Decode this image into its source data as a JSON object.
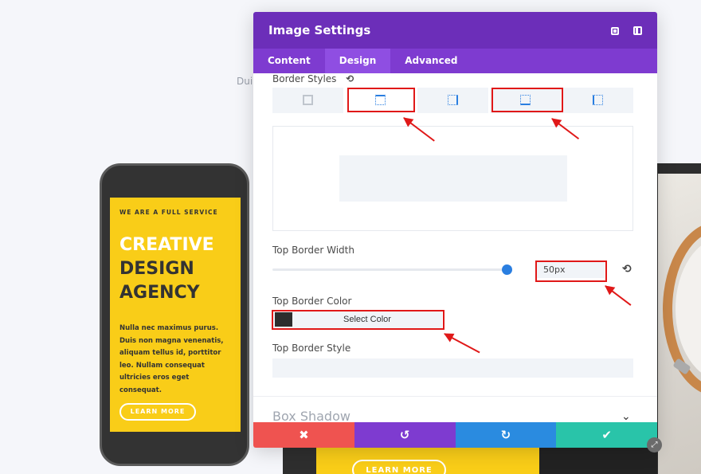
{
  "background": {
    "partial_text": "Dui"
  },
  "phone": {
    "kicker": "WE ARE A FULL SERVICE",
    "title_line1": "CREATIVE",
    "title_line2": "DESIGN",
    "title_line3": "AGENCY",
    "body": "Nulla nec maximus purus. Duis non magna venenatis, aliquam tellus id, porttitor leo. Nullam consequat ultricies eros eget consequat.",
    "button": "LEARN MORE"
  },
  "laptop": {
    "button": "LEARN MORE"
  },
  "modal": {
    "title": "Image Settings",
    "tabs": [
      {
        "label": "Content"
      },
      {
        "label": "Design"
      },
      {
        "label": "Advanced"
      }
    ],
    "active_tab": "Design",
    "border_styles_label": "Border Styles",
    "top_border_width_label": "Top Border Width",
    "top_border_width_value": "50px",
    "top_border_width_fraction": 0.98,
    "top_border_color_label": "Top Border Color",
    "select_color": "Select Color",
    "selected_color": "#2d2d2d",
    "top_border_style_label": "Top Border Style",
    "box_shadow_label": "Box Shadow"
  },
  "colors": {
    "header": "#6c2eb9",
    "tabs": "#7e3bd0",
    "accent": "#2a7ee0",
    "cancel": "#ef5350",
    "undo": "#7e3bd0",
    "redo": "#2a8be0",
    "save": "#29c4a9",
    "annotation": "#e01818",
    "phone_screen": "#f9cd18"
  },
  "icons": {
    "expand": "fullscreen-icon",
    "split": "split-view-icon",
    "reset": "undo-arrow-icon",
    "cancel": "x-icon",
    "undo": "undo-icon",
    "redo": "redo-icon",
    "save": "checkmark-icon",
    "collapse": "chevron-down-icon"
  },
  "glyphs": {
    "reset": "⟲",
    "cancel": "✖",
    "undo": "↺",
    "redo": "↻",
    "save": "✔",
    "chevron": "⌄",
    "resize": "⤢"
  }
}
